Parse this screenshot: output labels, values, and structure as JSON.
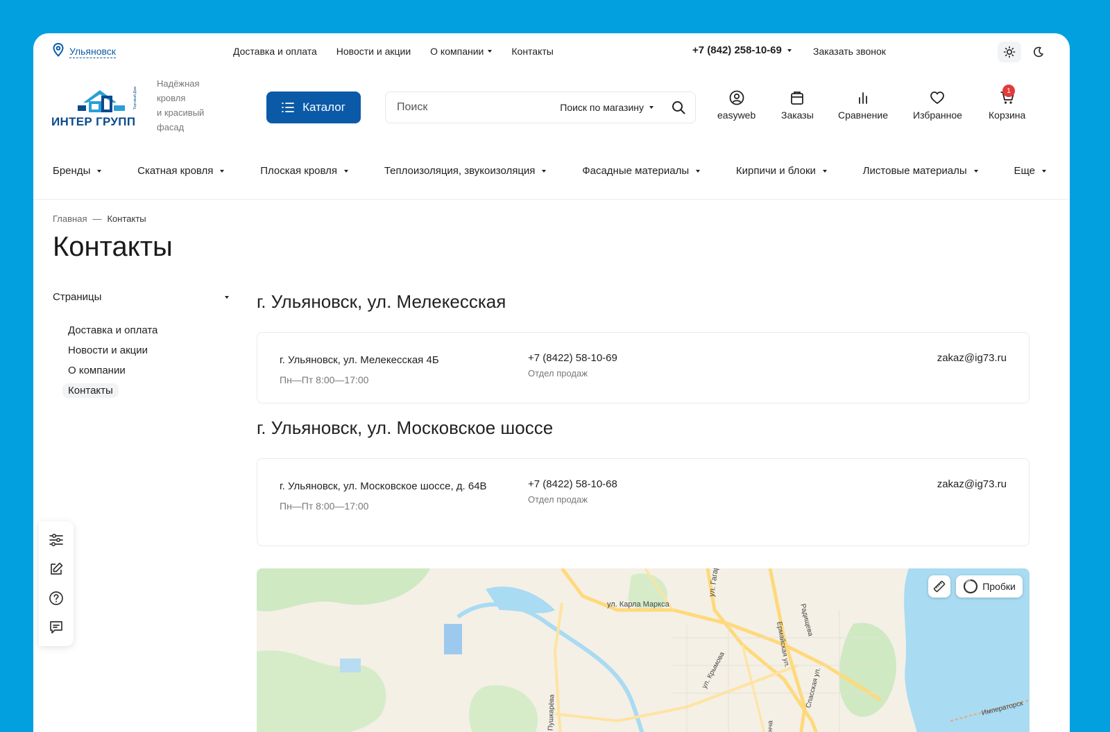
{
  "topbar": {
    "city": "Ульяновск",
    "nav": [
      "Доставка и оплата",
      "Новости и акции",
      "О компании",
      "Контакты"
    ],
    "phone": "+7 (842) 258-10-69",
    "callback": "Заказать звонок"
  },
  "header": {
    "logo_text": "ИНТЕР ГРУПП",
    "logo_small": "Торговый Дом",
    "slogan": [
      "Надёжная",
      "кровля",
      "и красивый",
      "фасад"
    ],
    "catalog_label": "Каталог",
    "search_placeholder": "Поиск",
    "search_scope": "Поиск по магазину",
    "icons": {
      "account": "easyweb",
      "orders": "Заказы",
      "compare": "Сравнение",
      "favorites": "Избранное",
      "cart": "Корзина",
      "cart_count": "1"
    }
  },
  "categories": [
    "Бренды",
    "Скатная кровля",
    "Плоская кровля",
    "Теплоизоляция, звукоизоляция",
    "Фасадные материалы",
    "Кирпичи и блоки",
    "Листовые материалы",
    "Еще"
  ],
  "breadcrumb": {
    "home": "Главная",
    "sep": "—",
    "current": "Контакты"
  },
  "page_title": "Контакты",
  "sidebar": {
    "heading": "Страницы",
    "items": [
      "Доставка и оплата",
      "Новости и акции",
      "О компании",
      "Контакты"
    ]
  },
  "locations": [
    {
      "title": "г. Ульяновск, ул. Мелекесская",
      "address": "г. Ульяновск, ул. Мелекесская 4Б",
      "hours": "Пн—Пт 8:00—17:00",
      "phone": "+7 (8422) 58-10-69",
      "dept": "Отдел продаж",
      "email": "zakaz@ig73.ru"
    },
    {
      "title": "г. Ульяновск, ул. Московское шоссе",
      "address": "г. Ульяновск, ул. Московское шоссе, д. 64В",
      "hours": "Пн—Пт 8:00—17:00",
      "phone": "+7 (8422) 58-10-68",
      "dept": "Отдел продаж",
      "email": "zakaz@ig73.ru"
    }
  ],
  "map": {
    "traffic_label": "Пробки",
    "streets": [
      "ул. Карла Маркса",
      "ул. Гагарина",
      "Ермайская ул.",
      "Радищева",
      "ул. Крымова",
      "Спасская ул.",
      "ул. Пушкарёва",
      "ул. Гонча",
      "Императорск"
    ]
  }
}
